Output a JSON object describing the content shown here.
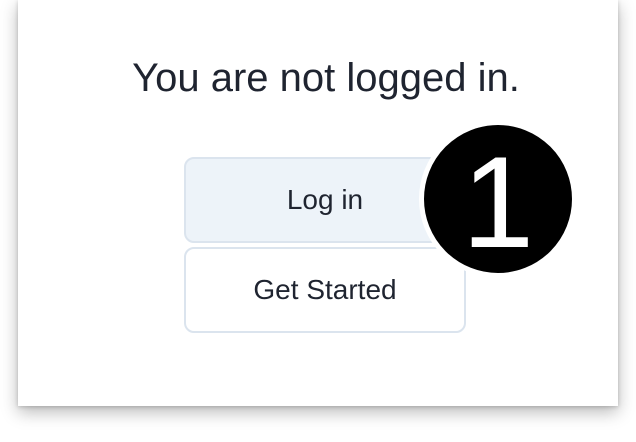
{
  "status": {
    "message": "You are not logged in."
  },
  "actions": {
    "login_label": "Log in",
    "get_started_label": "Get Started"
  },
  "annotation": {
    "step_number": "1"
  },
  "colors": {
    "text": "#1f2430",
    "login_button_bg": "#edf3f9",
    "button_border": "#dbe4ee",
    "badge_bg": "#000000"
  }
}
